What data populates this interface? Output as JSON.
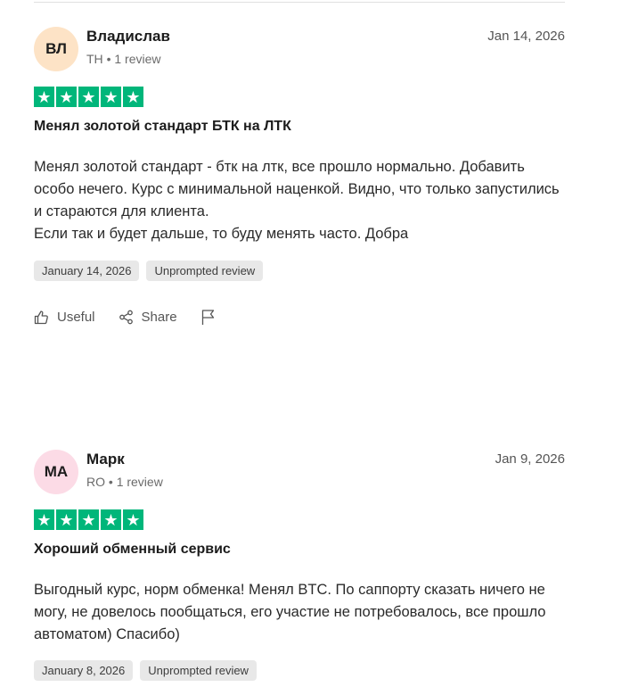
{
  "reviews": [
    {
      "initials": "ВЛ",
      "avatar_color": "#fde3c6",
      "name": "Владислав",
      "country": "TH",
      "review_count": "1 review",
      "date": "Jan 14, 2026",
      "rating": 5,
      "title": "Менял золотой стандарт БТК на ЛТК",
      "body_lines": [
        "Менял золотой стандарт - бтк на лтк, все прошло нормально. Добавить особо нечего. Курс с минимальной наценкой. Видно, что только запустились и стараются для клиента.",
        "Если так и будет дальше, то буду менять часто. Добра"
      ],
      "experience_date": "January 14, 2026",
      "tag": "Unprompted review",
      "actions": {
        "useful": "Useful",
        "share": "Share"
      }
    },
    {
      "initials": "МА",
      "avatar_color": "#fcdbe6",
      "name": "Марк",
      "country": "RO",
      "review_count": "1 review",
      "date": "Jan 9, 2026",
      "rating": 5,
      "title": "Хороший обменный сервис",
      "body_lines": [
        "Выгодный курс, норм обменка! Менял BTC. По саппорту сказать ничего не могу, не довелось пообщаться, его участие не потребовалось, все прошло автоматом) Спасибо)"
      ],
      "experience_date": "January 8, 2026",
      "tag": "Unprompted review"
    }
  ],
  "colors": {
    "star_green": "#00b67a",
    "tag_bg": "#e8e8e8"
  },
  "icons": [
    "star-icon",
    "thumbs-up-icon",
    "share-icon",
    "flag-icon"
  ]
}
